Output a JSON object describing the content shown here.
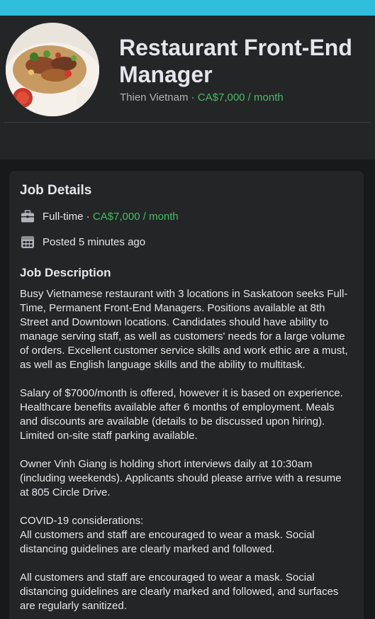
{
  "header": {
    "title": "Restaurant Front-End Manager",
    "company": "Thien Vietnam",
    "separator": " · ",
    "salary": "CA$7,000 / month"
  },
  "details": {
    "heading": "Job Details",
    "job_type": "Full-time",
    "separator": " · ",
    "salary": "CA$7,000 / month",
    "posted": "Posted 5 minutes ago",
    "icons": {
      "job_type": "briefcase-icon",
      "posted": "calendar-icon"
    }
  },
  "description": {
    "heading": "Job Description",
    "paragraph_1": "Busy Vietnamese restaurant with 3 locations in Saskatoon seeks Full-Time, Permanent Front-End Managers. Positions available at 8th Street and Downtown locations. Candidates should have ability to manage serving staff, as well as customers' needs for a large volume of orders. Excellent customer service skills and work ethic are a must, as well as English language skills and the ability to multitask.",
    "paragraph_2": "Salary of $7000/month is offered, however it is based on experience. Healthcare benefits available after 6 months of employment. Meals and discounts are available (details to be discussed upon hiring). Limited on-site staff parking available.",
    "paragraph_3": "Owner Vinh Giang is holding short interviews daily at 10:30am (including weekends). Applicants should please arrive with a resume at 805 Circle Drive.",
    "paragraph_4_line_1": "COVID-19 considerations:",
    "paragraph_4_line_2": "All customers and staff are encouraged to wear a mask. Social distancing guidelines are clearly marked and followed.",
    "paragraph_5": "All customers and staff are encouraged to wear a mask. Social distancing guidelines are clearly marked and followed, and surfaces are regularly sanitized."
  },
  "colors": {
    "accent_band": "#2fbfdc",
    "salary_green": "#45bd62",
    "background": "#18191a",
    "card": "#242526"
  }
}
